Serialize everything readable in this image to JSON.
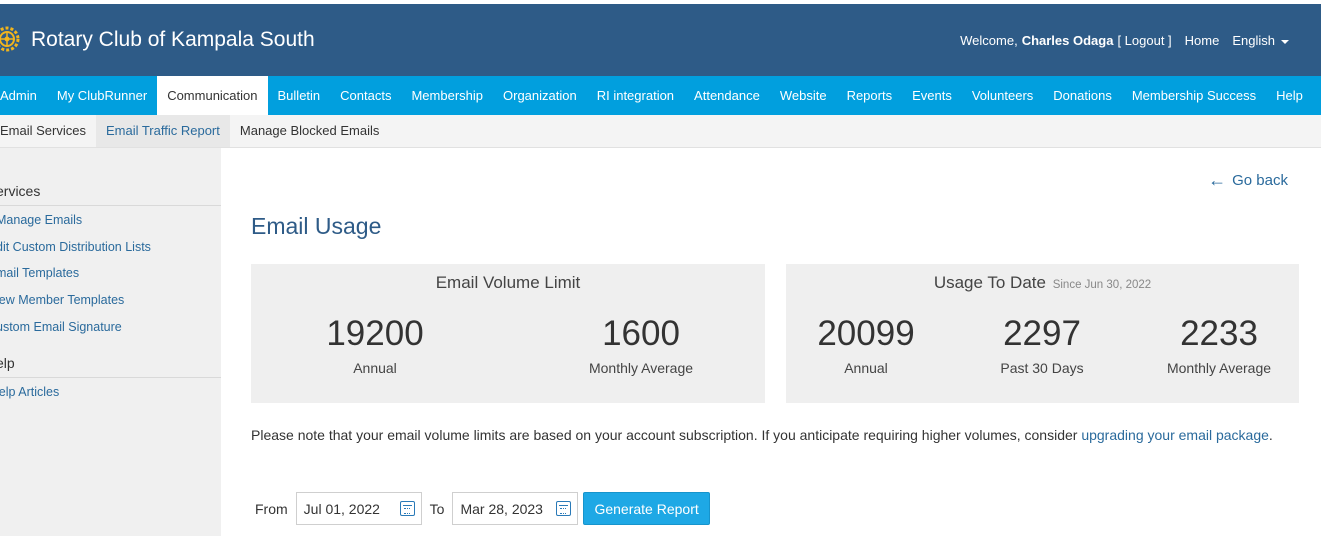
{
  "header": {
    "title": "Rotary Club of Kampala South",
    "welcome": "Welcome,",
    "user_name": "Charles Odaga",
    "logout": "[ Logout ]",
    "home": "Home",
    "language": "English",
    "brand_color": "#2e5b87"
  },
  "main_nav": {
    "accent": "#019fde",
    "items": [
      "Admin",
      "My ClubRunner",
      "Communication",
      "Bulletin",
      "Contacts",
      "Membership",
      "Organization",
      "RI integration",
      "Attendance",
      "Website",
      "Reports",
      "Events",
      "Volunteers",
      "Donations",
      "Membership Success",
      "Help"
    ],
    "active": "Communication"
  },
  "sub_nav": {
    "items": [
      "Email Services",
      "Email Traffic Report",
      "Manage Blocked Emails"
    ],
    "active": "Email Traffic Report"
  },
  "sidebar": {
    "section1": "ervices",
    "links1": [
      "Manage Emails",
      "dit Custom Distribution Lists",
      "mail Templates",
      "lew Member Templates",
      "ustom Email Signature"
    ],
    "section2": "elp",
    "links2": [
      "lelp Articles"
    ]
  },
  "content": {
    "go_back": "Go back",
    "page_title": "Email Usage",
    "volume_card": {
      "title": "Email Volume Limit",
      "stats": [
        {
          "value": "19200",
          "label": "Annual"
        },
        {
          "value": "1600",
          "label": "Monthly Average"
        }
      ]
    },
    "usage_card": {
      "title": "Usage To Date",
      "since": "Since Jun 30, 2022",
      "stats": [
        {
          "value": "20099",
          "label": "Annual"
        },
        {
          "value": "2297",
          "label": "Past 30 Days"
        },
        {
          "value": "2233",
          "label": "Monthly Average"
        }
      ]
    },
    "note_text": "Please note that your email volume limits are based on your account subscription. If you anticipate requiring higher volumes, consider ",
    "note_link": "upgrading your email package",
    "note_end": ".",
    "report": {
      "from_label": "From",
      "from_value": "Jul 01, 2022",
      "to_label": "To",
      "to_value": "Mar 28, 2023",
      "button": "Generate Report"
    }
  }
}
